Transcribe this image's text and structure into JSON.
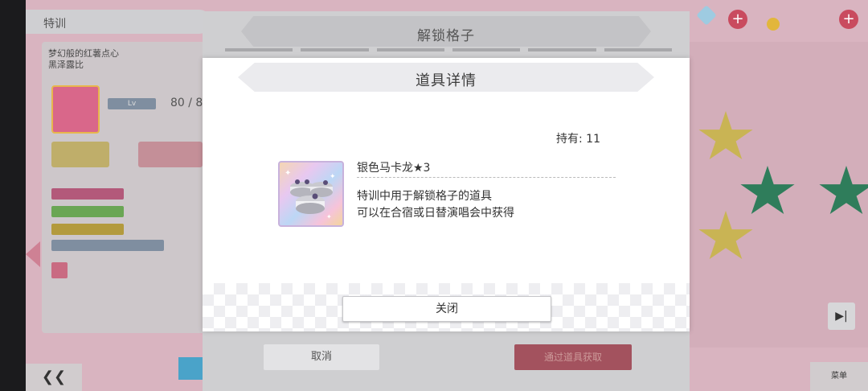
{
  "background": {
    "screen_title": "特训",
    "card": {
      "name_line1": "梦幻般的红薯点心",
      "name_line2": "黑泽露比",
      "level_label": "Lv",
      "level_value": "80 / 8"
    },
    "bottom_left_label": "❮❮",
    "bottom_right_label": "菜单"
  },
  "back_dialog": {
    "title": "解锁格子",
    "cancel_label": "取消",
    "confirm_label": "通过道具获取"
  },
  "modal": {
    "title": "道具详情",
    "held_text": "持有: 11",
    "item": {
      "icon": "silver-macaron-icon",
      "name": "银色马卡龙★3",
      "description": [
        "特训中用于解锁格子的道具",
        "可以在合宿或日替演唱会中获得"
      ]
    },
    "close_label": "关闭"
  },
  "colors": {
    "accent_pink": "#c94b5f",
    "star_gold": "#c9b454",
    "star_green": "#2f7d5b",
    "modal_bg": "#ffffff"
  }
}
